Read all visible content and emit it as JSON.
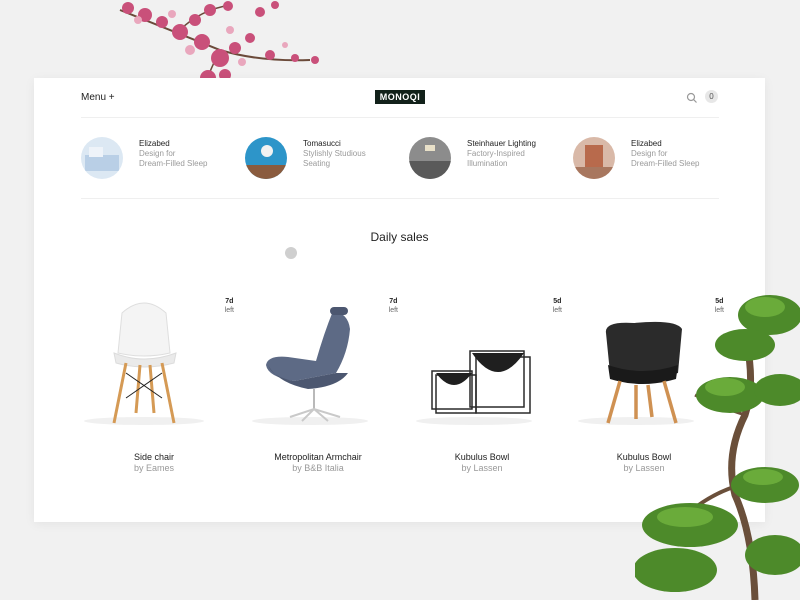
{
  "header": {
    "menu_label": "Menu +",
    "logo": "MONOQI",
    "search_icon": "search-icon",
    "cart_count": "0"
  },
  "stories": [
    {
      "brand": "Elizabed",
      "line1": "Design for",
      "line2": "Dream-Filled Sleep"
    },
    {
      "brand": "Tomasucci",
      "line1": "Stylishly Studious",
      "line2": "Seating"
    },
    {
      "brand": "Steinhauer Lighting",
      "line1": "Factory-Inspired",
      "line2": "Illumination"
    },
    {
      "brand": "Elizabed",
      "line1": "Design for",
      "line2": "Dream-Filled Sleep"
    }
  ],
  "section_title": "Daily sales",
  "products": [
    {
      "name": "Side chair",
      "by": "by Eames",
      "days": "7d",
      "left_label": "left"
    },
    {
      "name": "Metropolitan Armchair",
      "by": "by B&B Italia",
      "days": "7d",
      "left_label": "left"
    },
    {
      "name": "Kubulus Bowl",
      "by": "by Lassen",
      "days": "5d",
      "left_label": "left"
    },
    {
      "name": "Kubulus Bowl",
      "by": "by Lassen",
      "days": "5d",
      "left_label": "left"
    }
  ],
  "colors": {
    "background": "#f1f1f1",
    "logo_bg": "#12211a",
    "muted_text": "#9a9a9a"
  }
}
